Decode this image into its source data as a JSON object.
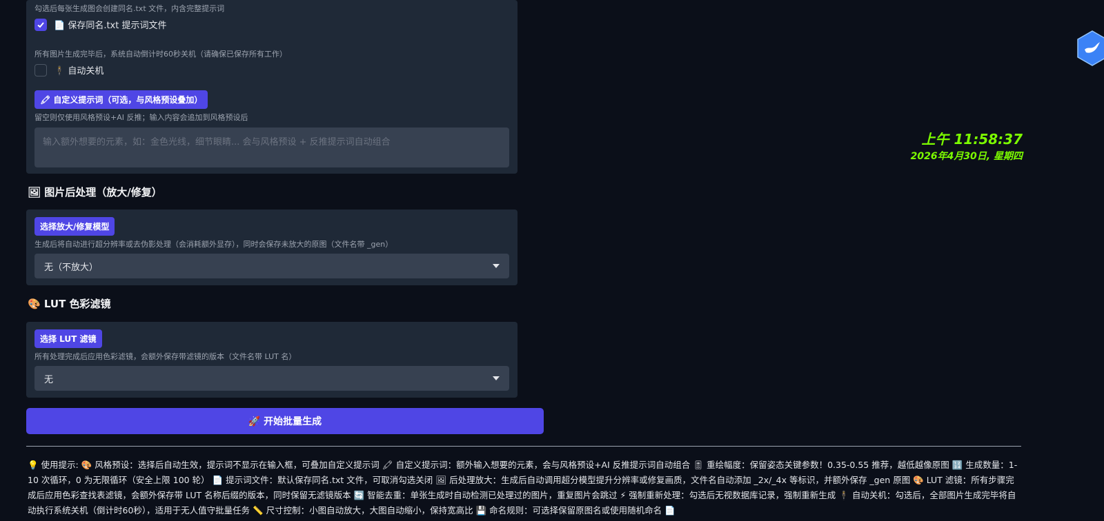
{
  "options_panel": {
    "txt_hint": "勾选后每张生成图会创建同名.txt 文件，内含完整提示词",
    "save_txt_label": "📄 保存同名.txt 提示词文件",
    "save_txt_checked": true,
    "shutdown_hint": "所有图片生成完毕后，系统自动倒计时60秒关机（请确保已保存所有工作）",
    "shutdown_label": "🕴 自动关机",
    "shutdown_checked": false,
    "custom_prompt_chip": "🖍 自定义提示词（可选，与风格预设叠加）",
    "custom_prompt_hint": "留空则仅使用风格预设+AI 反推；输入内容会追加到风格预设后",
    "custom_prompt_placeholder": "输入额外想要的元素，如：金色光线，细节眼睛... 会与风格预设 + 反推提示词自动组合",
    "custom_prompt_value": ""
  },
  "postprocess": {
    "title": "🖼 图片后处理（放大/修复）",
    "chip": "选择放大/修复模型",
    "hint": "生成后将自动进行超分辨率或去伪影处理（会消耗额外显存），同时会保存未放大的原图（文件名带 _gen）",
    "selected": "无（不放大）"
  },
  "lut": {
    "title": "🎨 LUT 色彩滤镜",
    "chip": "选择 LUT 滤镜",
    "hint": "所有处理完成后应用色彩滤镜，会额外保存带滤镜的版本（文件名带 LUT 名）",
    "selected": "无"
  },
  "run_button": {
    "label": "🚀 开始批量生成"
  },
  "tips": {
    "text": "💡 使用提示: 🎨 风格预设：选择后自动生效，提示词不显示在输入框，可叠加自定义提示词 🖍 自定义提示词：额外输入想要的元素，会与风格预设+AI 反推提示词自动组合 🎚 重绘幅度：保留姿态关键参数！0.35-0.55 推荐，越低越像原图 🔢 生成数量：1-10 次循环，0 为无限循环（安全上限 100 轮） 📄 提示词文件：默认保存同名.txt 文件，可取消勾选关闭 🖼 后处理放大：生成后自动调用超分模型提升分辨率或修复画质，文件名自动添加 _2x/_4x 等标识，并额外保存 _gen 原图 🎨 LUT 滤镜：所有步骤完成后应用色彩查找表滤镜，会额外保存带 LUT 名称后缀的版本，同时保留无滤镜版本 🔄 智能去重：单张生成时自动检测已处理过的图片，重复图片会跳过 ⚡ 强制重新处理：勾选后无视数据库记录，强制重新生成 🕴 自动关机：勾选后，全部图片生成完毕将自动执行系统关机（倒计时60秒），适用于无人值守批量任务 📏 尺寸控制：小图自动放大，大图自动缩小，保持宽高比 💾 命名规则：可选择保留原图名或使用随机命名 📄"
  },
  "clock": {
    "time": "上午 11:58:37",
    "date": "2026年4月30日, 星期四"
  },
  "colors": {
    "accent": "#4f46e5",
    "panel_bg": "#1f2937",
    "input_bg": "#374151",
    "page_bg": "#0b0f19",
    "clock_green": "#7cfc00",
    "logo_blue": "#3b82f6"
  },
  "icons": {
    "check": "check-icon",
    "caret": "chevron-down-icon",
    "logo": "bird-logo-icon"
  }
}
